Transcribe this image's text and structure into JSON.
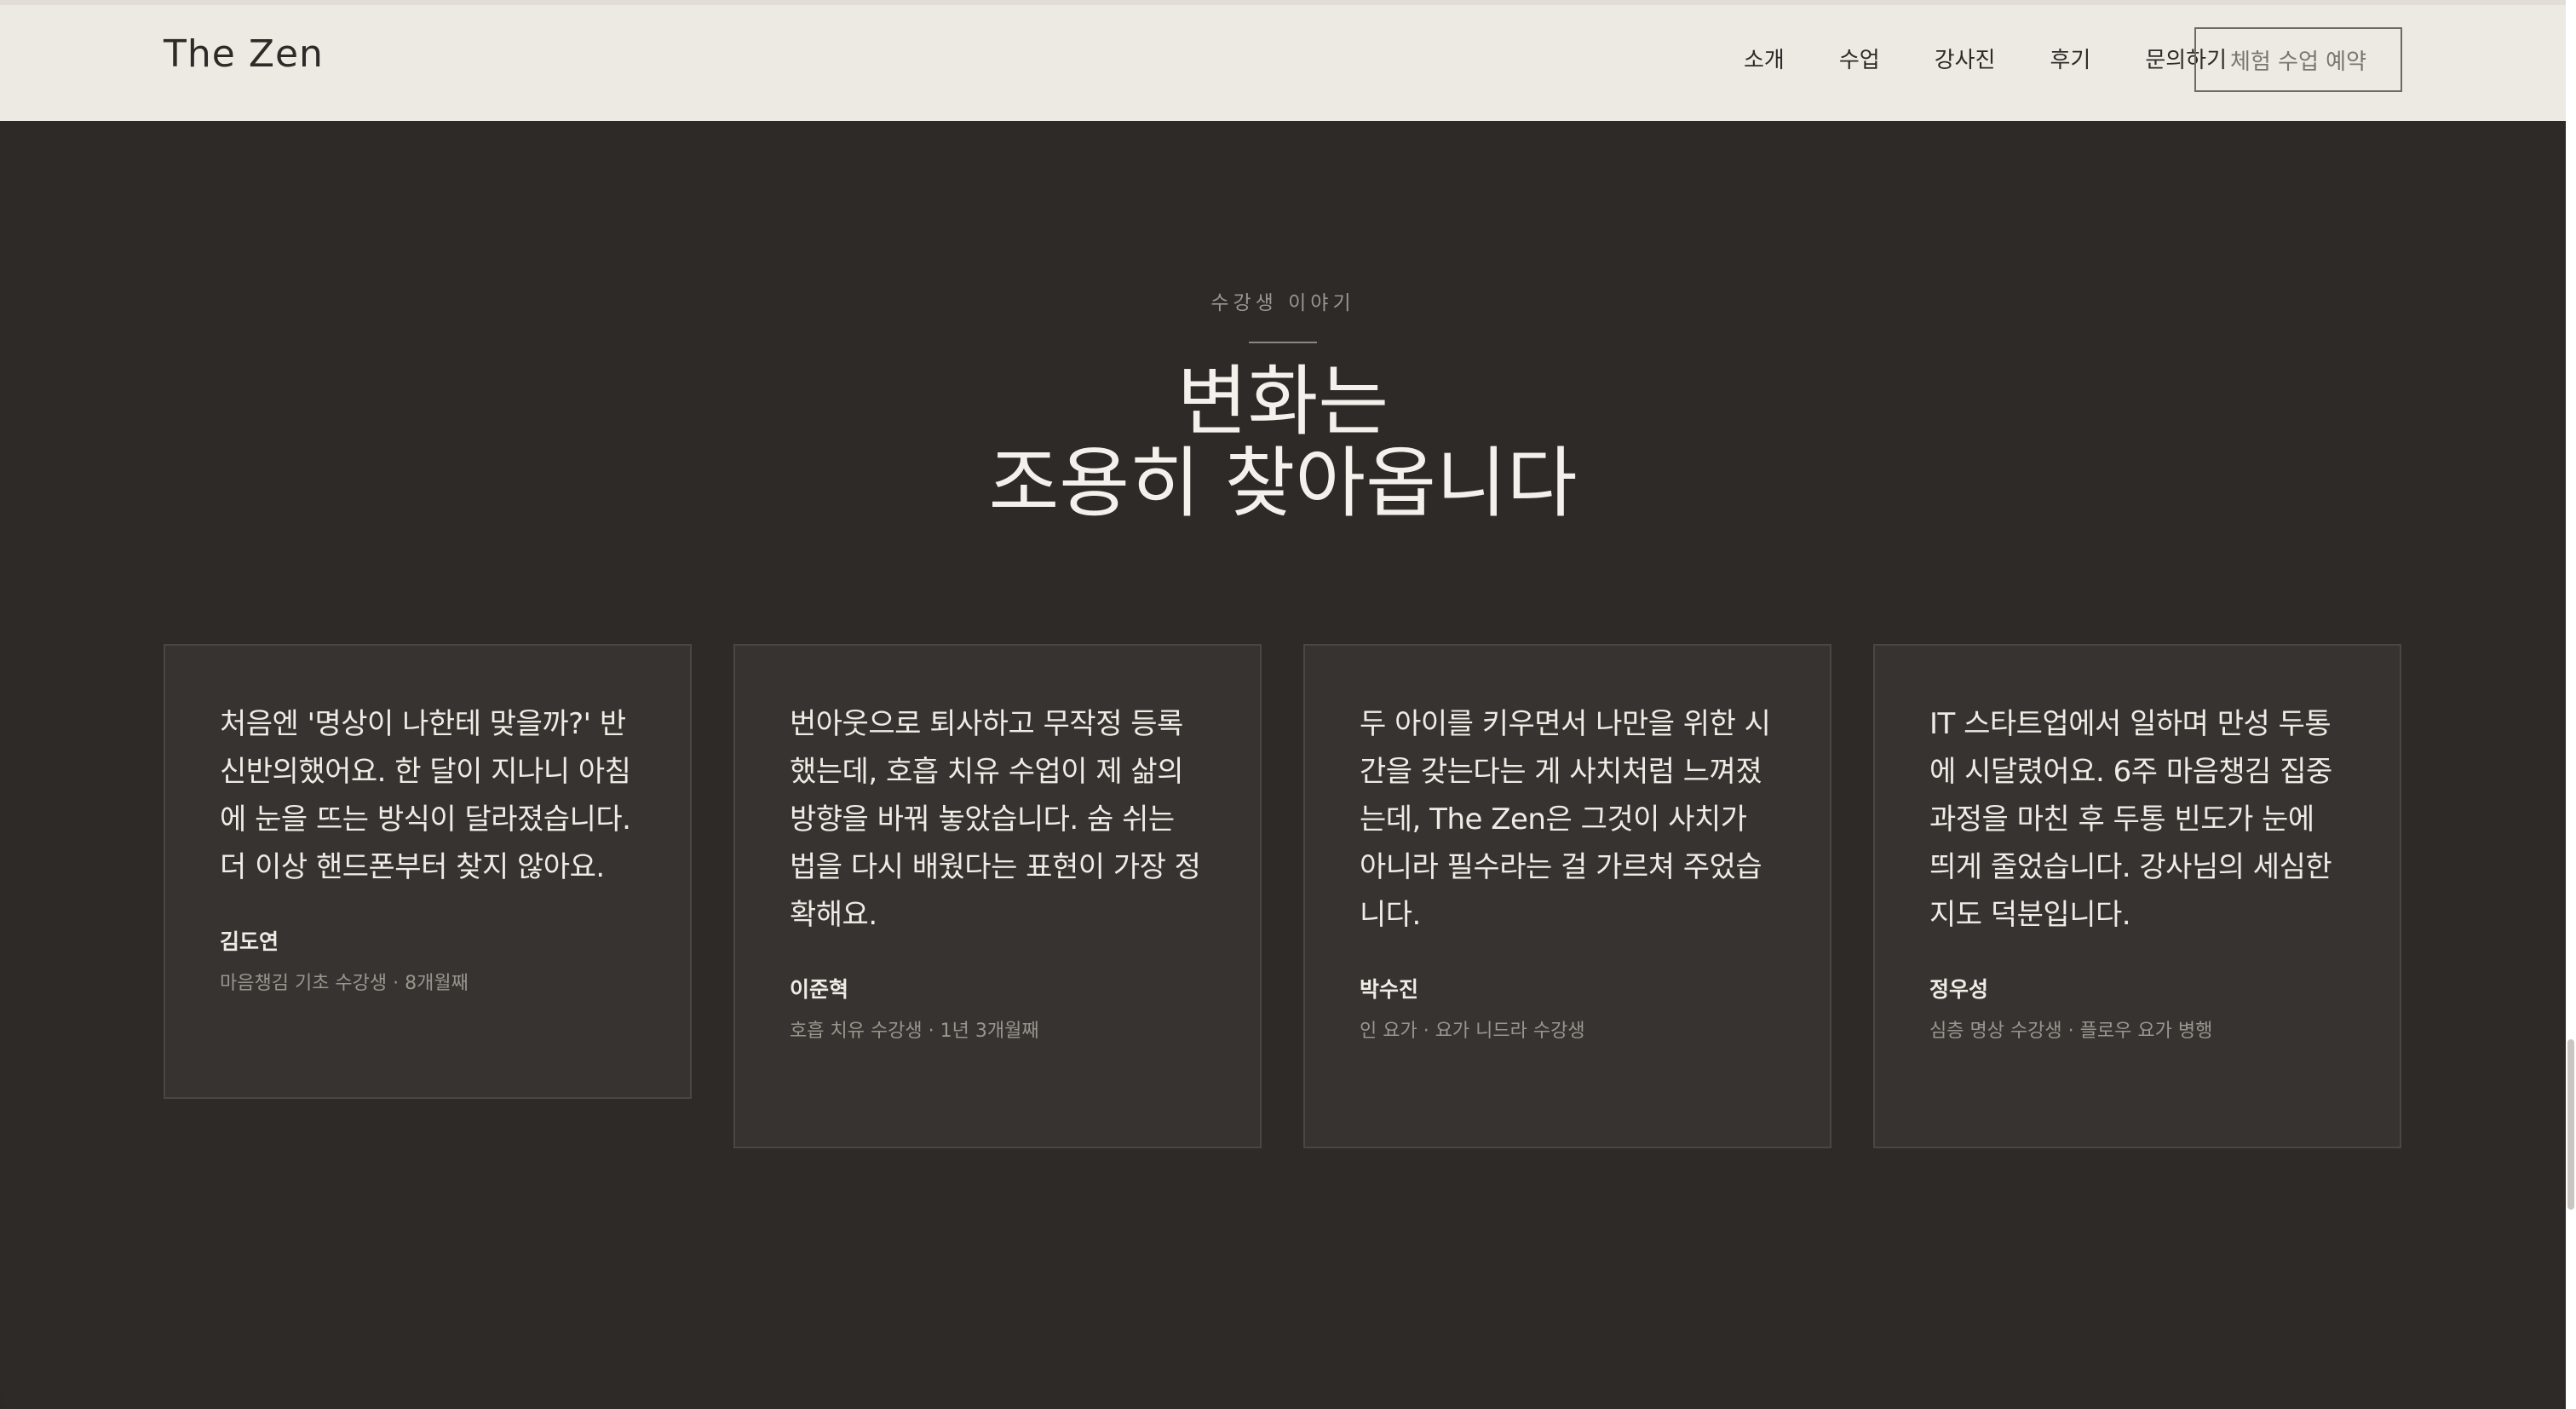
{
  "header": {
    "brand": "The Zen",
    "nav": [
      "소개",
      "수업",
      "강사진",
      "후기",
      "문의하기"
    ],
    "cta_label": "체험 수업 예약"
  },
  "section": {
    "eyebrow": "수강생 이야기",
    "heading_line1": "변화는",
    "heading_line2": "조용히 찾아옵니다"
  },
  "testimonials": [
    {
      "quote": "처음엔 '명상이 나한테 맞을까?' 반신반의했어요. 한 달이 지나니 아침에 눈을 뜨는 방식이 달라졌습니다. 더 이상 핸드폰부터 찾지 않아요.",
      "author": "김도연",
      "role": "마음챙김 기초 수강생 · 8개월째"
    },
    {
      "quote": "번아웃으로 퇴사하고 무작정 등록했는데, 호흡 치유 수업이 제 삶의 방향을 바꿔 놓았습니다. 숨 쉬는 법을 다시 배웠다는 표현이 가장 정확해요.",
      "author": "이준혁",
      "role": "호흡 치유 수강생 · 1년 3개월째"
    },
    {
      "quote": "두 아이를 키우면서 나만을 위한 시간을 갖는다는 게 사치처럼 느껴졌는데, The Zen은 그것이 사치가 아니라 필수라는 걸 가르쳐 주었습니다.",
      "author": "박수진",
      "role": "인 요가 · 요가 니드라 수강생"
    },
    {
      "quote": "IT 스타트업에서 일하며 만성 두통에 시달렸어요. 6주 마음챙김 집중 과정을 마친 후 두통 빈도가 눈에 띄게 줄었습니다. 강사님의 세심한 지도 덕분입니다.",
      "author": "정우성",
      "role": "심층 명상 수강생 · 플로우 요가 병행"
    }
  ]
}
